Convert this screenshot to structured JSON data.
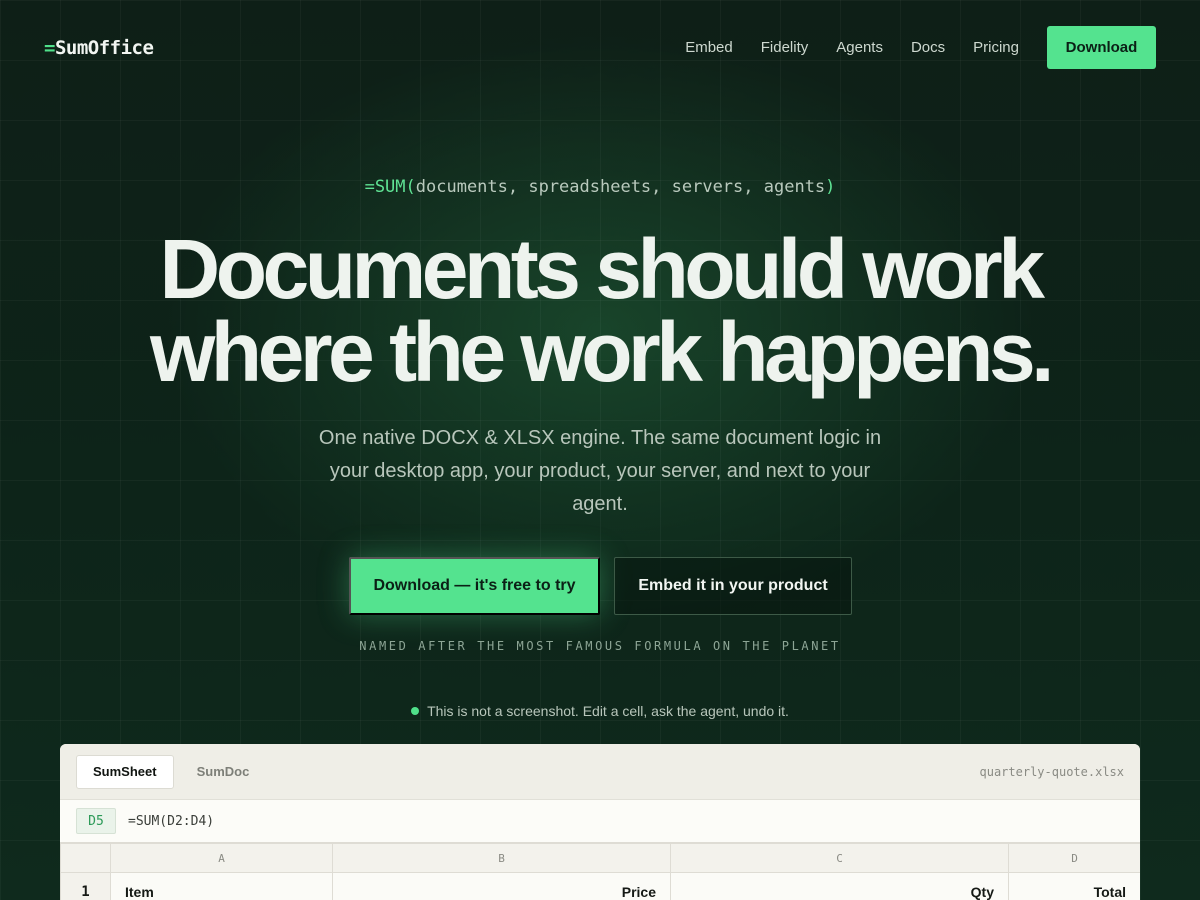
{
  "nav": {
    "logo_prefix": "=",
    "logo_name": "SumOffice",
    "links": [
      "Embed",
      "Fidelity",
      "Agents",
      "Docs",
      "Pricing"
    ],
    "cta": "Download"
  },
  "hero": {
    "formula_fn": "=SUM(",
    "formula_args": "documents, spreadsheets, servers, agents",
    "formula_close": ")",
    "headline_line1": "Documents should work",
    "headline_line2": "where the work happens.",
    "subhead": "One native DOCX & XLSX engine. The same document logic in your desktop app, your product, your server, and next to your agent.",
    "cta_primary": "Download — it's free to try",
    "cta_secondary": "Embed it in your product",
    "tagline": "NAMED AFTER THE MOST FAMOUS FORMULA ON THE PLANET",
    "notice": "This is not a screenshot. Edit a cell, ask the agent, undo it."
  },
  "sheet": {
    "tabs": [
      "SumSheet",
      "SumDoc"
    ],
    "active_tab": "SumSheet",
    "filename": "quarterly-quote.xlsx",
    "cell_ref": "D5",
    "formula": "=SUM(D2:D4)",
    "columns": [
      "A",
      "B",
      "C",
      "D"
    ],
    "rows": [
      {
        "num": "1",
        "cells": [
          "Item",
          "Price",
          "Qty",
          "Total"
        ]
      }
    ]
  },
  "colors": {
    "accent": "#54e38f",
    "background": "#0e1f17",
    "panel": "#fbfbf7"
  }
}
